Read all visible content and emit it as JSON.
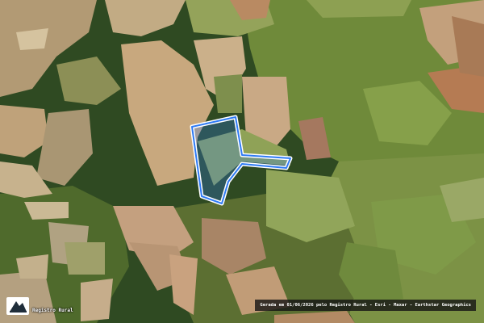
{
  "map": {
    "type": "satellite-imagery",
    "colors": {
      "forest": "#2f4a22",
      "pasture": "#8a9a4a",
      "bare_soil": "#c8a87e",
      "plowed_field": "#b59270",
      "boundary": "#2f7bf5",
      "boundary_outline": "#ffffff"
    }
  },
  "branding": {
    "logo_icon": "registro-rural-logo-icon",
    "logo_text": "Registro Rural"
  },
  "attribution": {
    "text": "Gerada em 01/06/2026 pelo Registro Rural - Esri - Maxar - Earthstar Geographics"
  }
}
